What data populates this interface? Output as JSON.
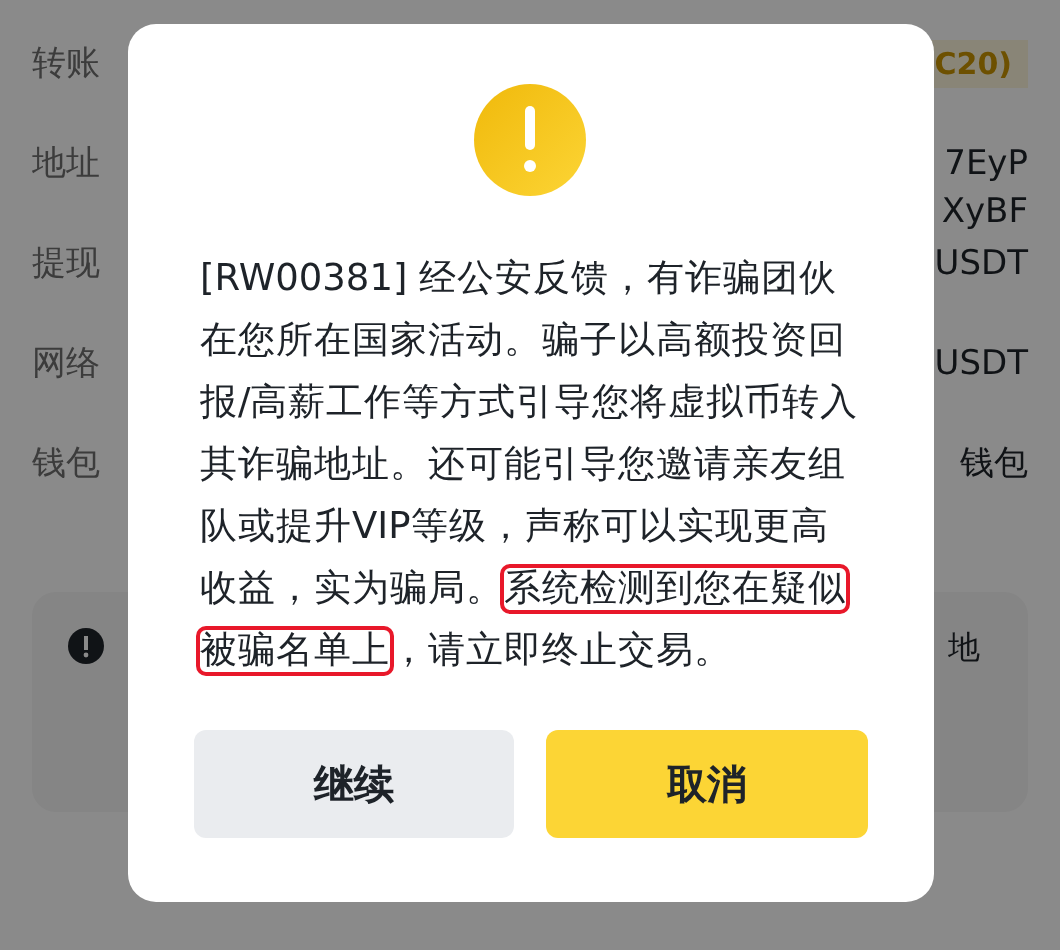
{
  "page": {
    "rows": [
      {
        "label": "转账",
        "values": [
          "C20)"
        ],
        "kind": "badge"
      },
      {
        "label": "地址",
        "values": [
          "7EyP",
          "XyBF"
        ],
        "kind": "text"
      },
      {
        "label": "提现",
        "values": [
          "USDT"
        ],
        "kind": "text"
      },
      {
        "label": "网络",
        "values": [
          "USDT"
        ],
        "kind": "text"
      },
      {
        "label": "钱包",
        "values": [
          "钱包"
        ],
        "kind": "text"
      }
    ],
    "notice": {
      "text": "地"
    }
  },
  "dialog": {
    "segments": [
      {
        "text": "[RW00381] 经公安反馈，有诈骗团伙在您所在国家活动。骗子以高额投资回报/高薪工作等方式引导您将虚拟币转入其诈骗地址。还可能引导您邀请亲友组队或提升VIP等级，声称可以实现更高收益，实为骗局。",
        "highlighted": false
      },
      {
        "text": "系统检测到您在疑似被骗名单上",
        "highlighted": true
      },
      {
        "text": "，请立即终止交易。",
        "highlighted": false
      }
    ],
    "buttons": [
      {
        "label": "继续",
        "kind": "secondary"
      },
      {
        "label": "取消",
        "kind": "primary"
      }
    ]
  }
}
